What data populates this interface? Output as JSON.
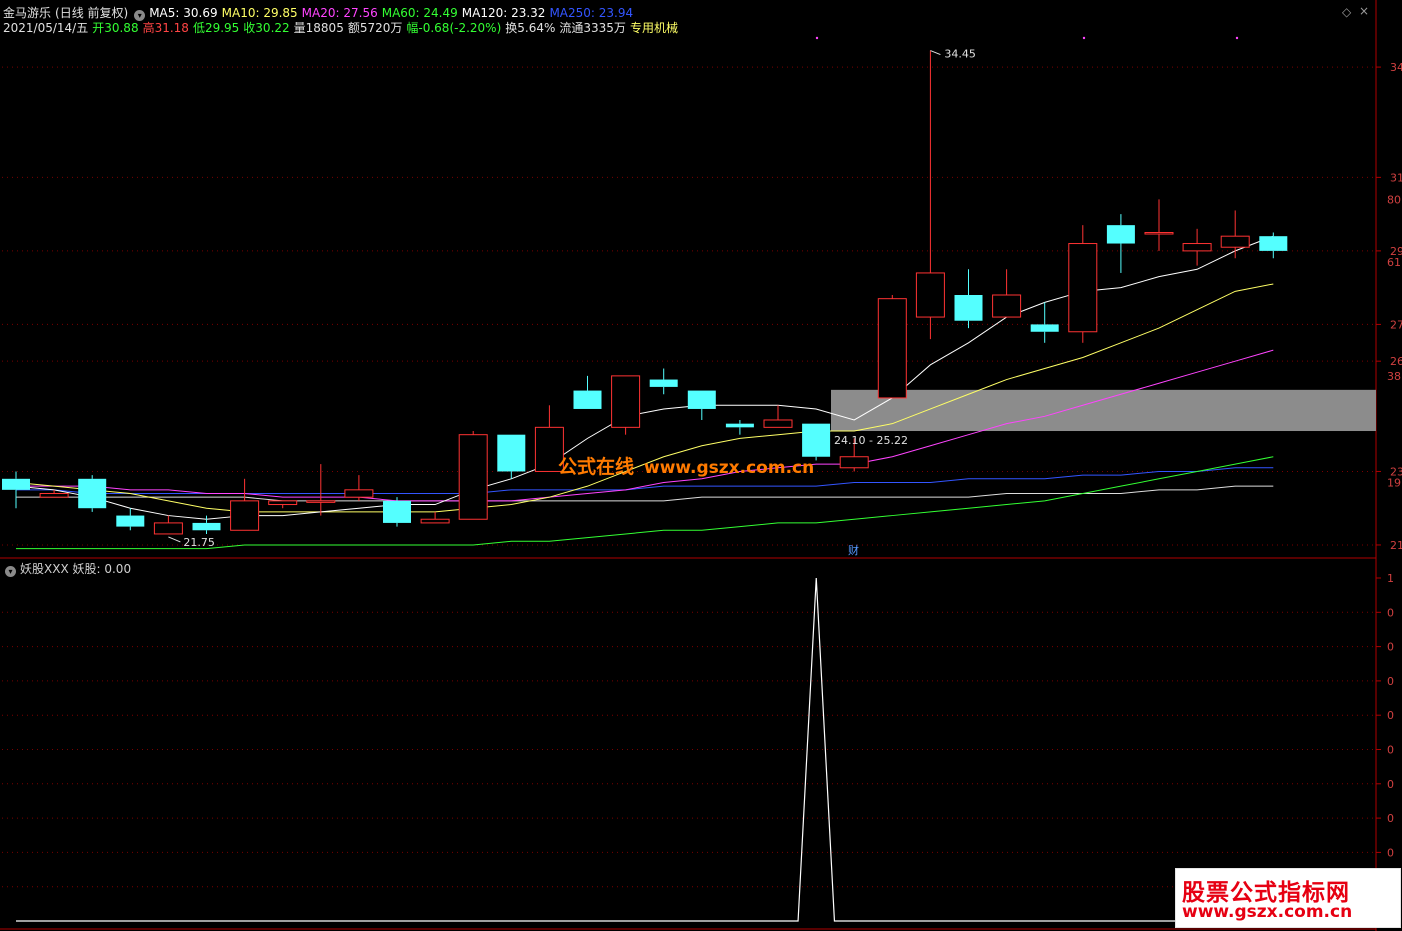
{
  "header": {
    "stock_name": "金马游乐",
    "period": "(日线 前复权)",
    "ma_items": [
      {
        "label": "MA5: 30.69",
        "color": "#ffffff"
      },
      {
        "label": "MA10: 29.85",
        "color": "#ffff66"
      },
      {
        "label": "MA20: 27.56",
        "color": "#ff44ff"
      },
      {
        "label": "MA60: 24.49",
        "color": "#33ff33"
      },
      {
        "label": "MA120: 23.32",
        "color": "#ffffff"
      },
      {
        "label": "MA250: 23.94",
        "color": "#3355ff"
      }
    ]
  },
  "quote": {
    "date": "2021/05/14/五",
    "items": [
      {
        "label": "开30.88",
        "color": "#33ff33"
      },
      {
        "label": "高31.18",
        "color": "#ff4444"
      },
      {
        "label": "低29.95",
        "color": "#33ff33"
      },
      {
        "label": "收30.22",
        "color": "#33ff33"
      },
      {
        "label": "量18805",
        "color": "#e0e0e0"
      },
      {
        "label": "额5720万",
        "color": "#e0e0e0"
      },
      {
        "label": "幅-0.68(-2.20%)",
        "color": "#33ff33"
      },
      {
        "label": "换5.64%",
        "color": "#e0e0e0"
      },
      {
        "label": "流通3335万",
        "color": "#e0e0e0"
      },
      {
        "label": "专用机械",
        "color": "#ffff66"
      }
    ]
  },
  "controls": {
    "diamond": "◇",
    "close": "×"
  },
  "price_axis": {
    "labels": [
      {
        "value": 34,
        "text": "34"
      },
      {
        "value": 31,
        "text": "31"
      },
      {
        "value": 29,
        "text": "29"
      },
      {
        "value": 27,
        "text": "27"
      },
      {
        "value": 26,
        "text": "26"
      },
      {
        "value": 23,
        "text": "23"
      },
      {
        "value": 21,
        "text": "21"
      }
    ],
    "pct_labels": [
      {
        "value": 30.4,
        "text": "80."
      },
      {
        "value": 28.7,
        "text": "61."
      },
      {
        "value": 25.6,
        "text": "38."
      },
      {
        "value": 22.7,
        "text": "19."
      }
    ]
  },
  "annotations": {
    "high_label": "34.45",
    "low_label": "21.75",
    "range_label": "24.10 - 25.22",
    "event_marker": "财"
  },
  "sub_panel": {
    "title": "妖股XXX",
    "value_label": "妖股: 0.00",
    "ticks": [
      "1",
      "0",
      "0",
      "0",
      "0",
      "0",
      "0",
      "0",
      "0",
      "0",
      "0"
    ]
  },
  "watermark": {
    "text": "公式在线",
    "url": "www.gszx.com.cn"
  },
  "brand": {
    "title": "股票公式指标网",
    "url": "www.gszx.com.cn"
  },
  "chart_data": {
    "type": "candlestick",
    "candles": [
      {
        "o": 22.8,
        "c": 22.5,
        "h": 23.0,
        "l": 22.0
      },
      {
        "o": 22.3,
        "c": 22.4,
        "h": 22.5,
        "l": 22.3
      },
      {
        "o": 22.8,
        "c": 22.0,
        "h": 22.9,
        "l": 21.9
      },
      {
        "o": 21.8,
        "c": 21.5,
        "h": 22.0,
        "l": 21.4
      },
      {
        "o": 21.3,
        "c": 21.6,
        "h": 21.8,
        "l": 21.3
      },
      {
        "o": 21.6,
        "c": 21.4,
        "h": 21.8,
        "l": 21.3
      },
      {
        "o": 21.4,
        "c": 22.2,
        "h": 22.8,
        "l": 21.4
      },
      {
        "o": 22.1,
        "c": 22.2,
        "h": 22.2,
        "l": 22.0
      },
      {
        "o": 22.2,
        "c": 22.2,
        "h": 23.2,
        "l": 21.8
      },
      {
        "o": 22.3,
        "c": 22.5,
        "h": 22.9,
        "l": 22.2
      },
      {
        "o": 22.2,
        "c": 21.6,
        "h": 22.3,
        "l": 21.5
      },
      {
        "o": 21.6,
        "c": 21.7,
        "h": 21.9,
        "l": 21.6
      },
      {
        "o": 21.7,
        "c": 24.0,
        "h": 24.1,
        "l": 21.7
      },
      {
        "o": 24.0,
        "c": 23.0,
        "h": 24.0,
        "l": 22.8
      },
      {
        "o": 23.0,
        "c": 24.2,
        "h": 24.8,
        "l": 23.0
      },
      {
        "o": 25.2,
        "c": 24.7,
        "h": 25.6,
        "l": 24.7
      },
      {
        "o": 24.2,
        "c": 25.6,
        "h": 25.6,
        "l": 24.0
      },
      {
        "o": 25.5,
        "c": 25.3,
        "h": 25.8,
        "l": 25.1
      },
      {
        "o": 25.2,
        "c": 24.7,
        "h": 25.2,
        "l": 24.4
      },
      {
        "o": 24.3,
        "c": 24.2,
        "h": 24.4,
        "l": 24.0
      },
      {
        "o": 24.2,
        "c": 24.4,
        "h": 24.8,
        "l": 24.2
      },
      {
        "o": 24.3,
        "c": 23.4,
        "h": 24.3,
        "l": 23.3
      },
      {
        "o": 23.1,
        "c": 23.4,
        "h": 23.9,
        "l": 23.0
      },
      {
        "o": 25.0,
        "c": 27.7,
        "h": 27.8,
        "l": 25.0
      },
      {
        "o": 27.2,
        "c": 28.4,
        "h": 34.45,
        "l": 26.6
      },
      {
        "o": 27.8,
        "c": 27.1,
        "h": 28.5,
        "l": 26.9
      },
      {
        "o": 27.2,
        "c": 27.8,
        "h": 28.5,
        "l": 27.2
      },
      {
        "o": 27.0,
        "c": 26.8,
        "h": 27.6,
        "l": 26.5
      },
      {
        "o": 26.8,
        "c": 29.2,
        "h": 29.7,
        "l": 26.5
      },
      {
        "o": 29.7,
        "c": 29.2,
        "h": 30.0,
        "l": 28.4
      },
      {
        "o": 29.5,
        "c": 29.5,
        "h": 30.4,
        "l": 29.0
      },
      {
        "o": 29.0,
        "c": 29.2,
        "h": 29.6,
        "l": 28.6
      },
      {
        "o": 29.1,
        "c": 29.4,
        "h": 30.1,
        "l": 28.8
      },
      {
        "o": 29.4,
        "c": 29.0,
        "h": 29.5,
        "l": 28.8
      }
    ],
    "ma5": [
      22.6,
      22.5,
      22.3,
      22.0,
      21.8,
      21.7,
      21.8,
      21.8,
      21.9,
      22.0,
      22.1,
      22.1,
      22.5,
      22.8,
      23.2,
      23.9,
      24.5,
      24.7,
      24.8,
      24.8,
      24.8,
      24.7,
      24.4,
      25.0,
      25.9,
      26.5,
      27.2,
      27.6,
      27.9,
      28.0,
      28.3,
      28.5,
      29.0,
      29.4
    ],
    "ma10": [
      22.7,
      22.6,
      22.5,
      22.4,
      22.2,
      22.0,
      21.9,
      21.9,
      21.9,
      21.9,
      21.9,
      21.9,
      22.0,
      22.1,
      22.3,
      22.6,
      23.0,
      23.4,
      23.7,
      23.9,
      24.0,
      24.1,
      24.1,
      24.3,
      24.7,
      25.1,
      25.5,
      25.8,
      26.1,
      26.5,
      26.9,
      27.4,
      27.9,
      28.1
    ],
    "ma20": [
      22.6,
      22.6,
      22.6,
      22.5,
      22.5,
      22.4,
      22.4,
      22.3,
      22.3,
      22.3,
      22.2,
      22.2,
      22.2,
      22.2,
      22.3,
      22.4,
      22.5,
      22.7,
      22.8,
      23.0,
      23.1,
      23.2,
      23.2,
      23.4,
      23.7,
      24.0,
      24.3,
      24.5,
      24.8,
      25.1,
      25.4,
      25.7,
      26.0,
      26.3
    ],
    "ma60": [
      20.9,
      20.9,
      20.9,
      20.9,
      20.9,
      20.9,
      21.0,
      21.0,
      21.0,
      21.0,
      21.0,
      21.0,
      21.0,
      21.1,
      21.1,
      21.2,
      21.3,
      21.4,
      21.4,
      21.5,
      21.6,
      21.6,
      21.7,
      21.8,
      21.9,
      22.0,
      22.1,
      22.2,
      22.4,
      22.6,
      22.8,
      23.0,
      23.2,
      23.4
    ],
    "ma120": [
      22.3,
      22.3,
      22.3,
      22.3,
      22.3,
      22.3,
      22.3,
      22.2,
      22.2,
      22.2,
      22.2,
      22.2,
      22.2,
      22.2,
      22.2,
      22.2,
      22.2,
      22.2,
      22.3,
      22.3,
      22.3,
      22.3,
      22.3,
      22.3,
      22.3,
      22.3,
      22.4,
      22.4,
      22.4,
      22.4,
      22.5,
      22.5,
      22.6,
      22.6
    ],
    "ma250": [
      22.5,
      22.5,
      22.4,
      22.4,
      22.4,
      22.4,
      22.4,
      22.4,
      22.4,
      22.4,
      22.4,
      22.4,
      22.4,
      22.5,
      22.5,
      22.5,
      22.5,
      22.6,
      22.6,
      22.6,
      22.6,
      22.6,
      22.7,
      22.7,
      22.7,
      22.8,
      22.8,
      22.8,
      22.9,
      22.9,
      23.0,
      23.0,
      23.1,
      23.1
    ],
    "indicator": [
      0,
      0,
      0,
      0,
      0,
      0,
      0,
      0,
      0,
      0,
      0,
      0,
      0,
      0,
      0,
      0,
      0,
      0,
      0,
      0,
      0,
      0,
      0,
      0,
      0,
      0,
      0,
      0,
      0,
      0,
      0,
      0,
      0,
      0,
      0,
      0,
      0,
      0,
      0,
      0,
      0,
      0,
      0,
      0,
      1,
      0,
      0,
      0,
      0,
      0,
      0,
      0,
      0,
      0,
      0,
      0,
      0,
      0,
      0,
      0,
      0,
      0,
      0,
      0,
      0
    ],
    "price_range": [
      20.7,
      34.9
    ],
    "highlight_zone": [
      24.1,
      25.22
    ]
  }
}
